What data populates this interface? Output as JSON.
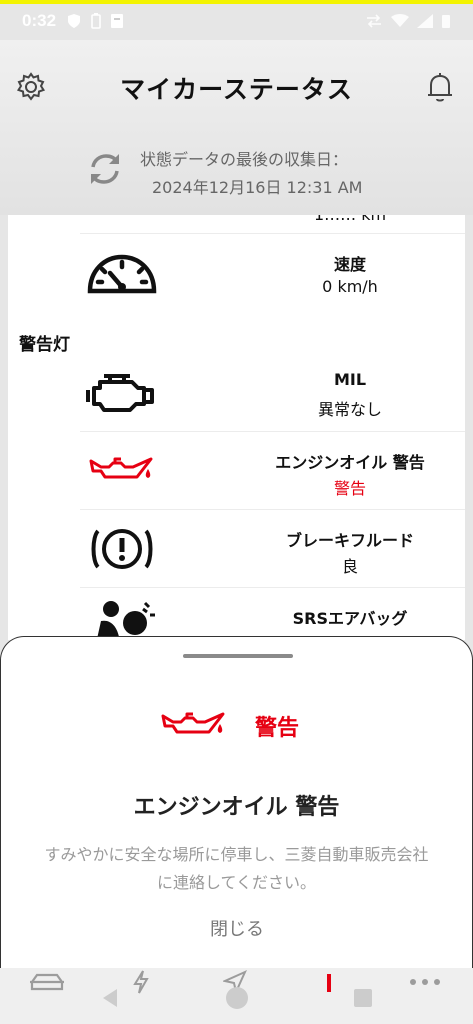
{
  "status_bar": {
    "time": "0:32"
  },
  "header": {
    "title": "マイカーステータス",
    "last_updated_label": "状態データの最後の収集日：",
    "last_updated_value": "2024年12月16日 12:31 AM"
  },
  "status_rows": {
    "partial_value": "1…… km",
    "speed": {
      "name": "速度",
      "value": "0 km/h"
    }
  },
  "warning_section": {
    "title": "警告灯",
    "items": [
      {
        "name": "MIL",
        "value": "異常なし",
        "icon": "engine-icon",
        "status": "normal"
      },
      {
        "name": "エンジンオイル 警告",
        "value": "警告",
        "icon": "oil-can-icon",
        "status": "warning"
      },
      {
        "name": "ブレーキフルード",
        "value": "良",
        "icon": "brake-warning-icon",
        "status": "normal"
      },
      {
        "name": "SRSエアバッグ",
        "value": "",
        "icon": "airbag-icon",
        "status": "normal"
      }
    ]
  },
  "sheet": {
    "status_text": "警告",
    "title": "エンジンオイル 警告",
    "message": "すみやかに安全な場所に停車し、三菱自動車販売会社に連絡してください。",
    "close_label": "閉じる"
  },
  "bottom_nav": [
    "car-icon",
    "lightning-icon",
    "navigation-icon",
    "status-icon",
    "more-icon"
  ],
  "colors": {
    "warning": "#e60012",
    "accent_yellow": "#f3f300"
  }
}
